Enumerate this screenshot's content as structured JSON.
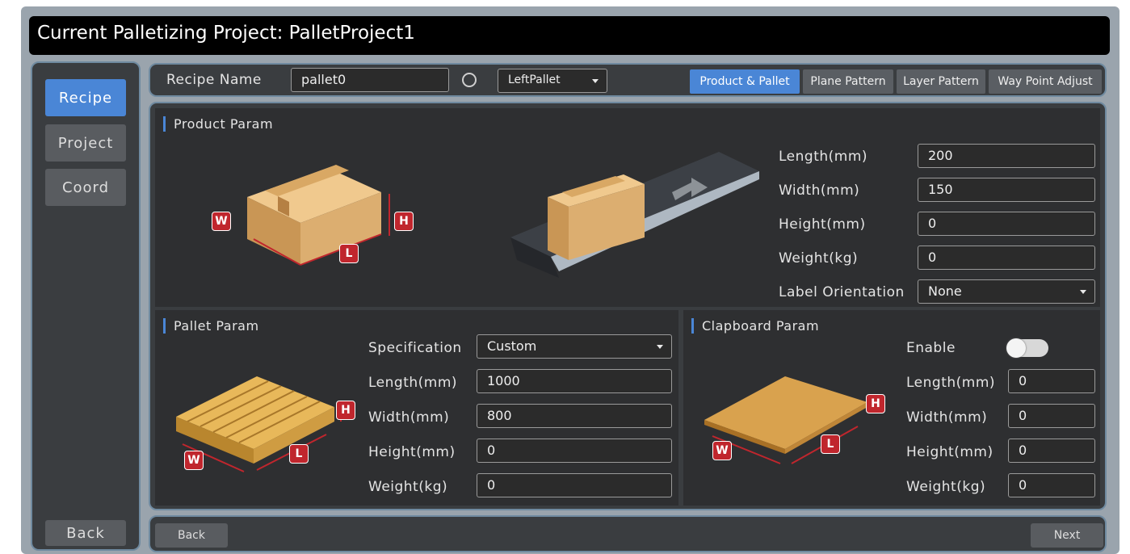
{
  "title": "Current Palletizing Project: PalletProject1",
  "sidebar": {
    "items": [
      {
        "label": "Recipe",
        "active": true
      },
      {
        "label": "Project",
        "active": false
      },
      {
        "label": "Coord",
        "active": false
      }
    ],
    "back_label": "Back"
  },
  "topbar": {
    "recipe_name_label": "Recipe Name",
    "recipe_name_value": "pallet0",
    "pallet_select_value": "LeftPallet",
    "tabs": [
      {
        "label": "Product & Pallet",
        "active": true
      },
      {
        "label": "Plane Pattern",
        "active": false
      },
      {
        "label": "Layer Pattern",
        "active": false
      },
      {
        "label": "Way Point Adjust",
        "active": false
      }
    ]
  },
  "product": {
    "title": "Product Param",
    "badges": {
      "w": "W",
      "h": "H",
      "l": "L"
    },
    "fields": [
      {
        "label": "Length(mm)",
        "value": "200"
      },
      {
        "label": "Width(mm)",
        "value": "150"
      },
      {
        "label": "Height(mm)",
        "value": "0"
      },
      {
        "label": "Weight(kg)",
        "value": "0"
      }
    ],
    "label_orientation_label": "Label Orientation",
    "label_orientation_value": "None"
  },
  "pallet": {
    "title": "Pallet Param",
    "badges": {
      "w": "W",
      "h": "H",
      "l": "L"
    },
    "specification_label": "Specification",
    "specification_value": "Custom",
    "fields": [
      {
        "label": "Length(mm)",
        "value": "1000"
      },
      {
        "label": "Width(mm)",
        "value": "800"
      },
      {
        "label": "Height(mm)",
        "value": "0"
      },
      {
        "label": "Weight(kg)",
        "value": "0"
      }
    ]
  },
  "clapboard": {
    "title": "Clapboard Param",
    "badges": {
      "w": "W",
      "h": "H",
      "l": "L"
    },
    "enable_label": "Enable",
    "enabled": false,
    "fields": [
      {
        "label": "Length(mm)",
        "value": "0"
      },
      {
        "label": "Width(mm)",
        "value": "0"
      },
      {
        "label": "Height(mm)",
        "value": "0"
      },
      {
        "label": "Weight(kg)",
        "value": "0"
      }
    ]
  },
  "bottom": {
    "back_label": "Back",
    "next_label": "Next"
  },
  "colors": {
    "accent": "#4a86d6",
    "badge": "#c0262d",
    "panel": "#2e2f31",
    "frame_border": "#6f8aa0"
  }
}
